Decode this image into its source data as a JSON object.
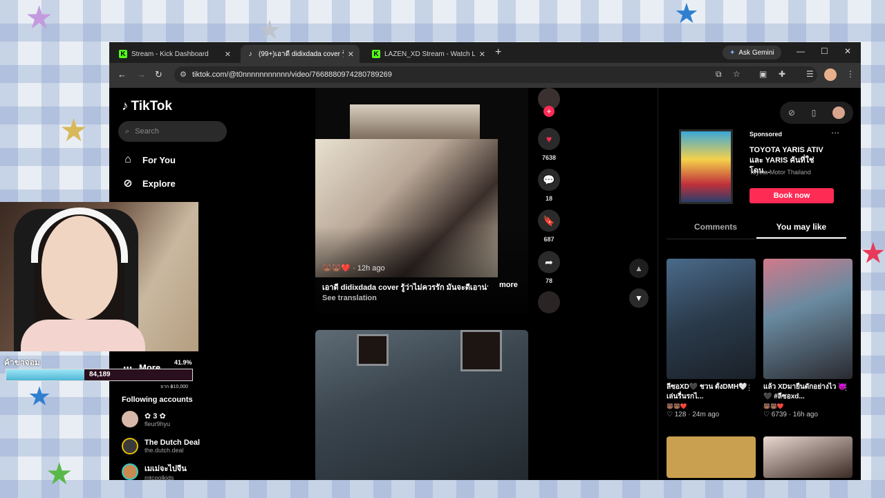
{
  "browser": {
    "tabs": [
      {
        "title": "Stream - Kick Dashboard",
        "favicon": "kick-icon"
      },
      {
        "title": "(99+)เอาดี didixdada cover รู้ว่าไม่",
        "favicon": "tiktok-icon"
      },
      {
        "title": "LAZEN_XD Stream - Watch Live",
        "favicon": "kick-icon"
      }
    ],
    "ask_gemini": "Ask Gemini",
    "url": "tiktok.com/@t0nnnnnnnnnnn/video/7668880974280789269"
  },
  "sidebar": {
    "logo": "TikTok",
    "search_placeholder": "Search",
    "nav": [
      {
        "label": "For You",
        "icon": "home-icon"
      },
      {
        "label": "Explore",
        "icon": "compass-icon"
      }
    ],
    "more": "More",
    "following_header": "Following accounts",
    "following": [
      {
        "name": "✿ 3 ✿",
        "handle": "fleur9hyu"
      },
      {
        "name": "The Dutch Deal",
        "handle": "the.dutch.deal"
      },
      {
        "name": "เมเม่จะไปจีน",
        "handle": "mtcoolkids"
      }
    ]
  },
  "video": {
    "time": "12h ago",
    "caption": "เอาดี didixdada cover รู้ว่าไม่ควรรัก มันจะดีเอาน่า",
    "more": "more",
    "see_translation": "See translation"
  },
  "actions": {
    "likes": "7638",
    "comments": "18",
    "saves": "687",
    "shares": "78"
  },
  "ad": {
    "sponsored": "Sponsored",
    "title": "TOYOTA YARIS ATIV และ YARIS คันที่ใช่ โดน...",
    "brand": "Toyota Motor Thailand",
    "cta": "Book now"
  },
  "right_tabs": [
    "Comments",
    "You may like"
  ],
  "cards": [
    {
      "title": "ลีซอXD🖤 ชวน ตั้งDMH🤍 เล่นรื่นรกไ...",
      "emoji": "🐻🐻❤️",
      "likes": "128",
      "time": "24m ago"
    },
    {
      "title": "แล้ว XDมายืนดักอย่างไว 👿🖤 #ลีซอxd...",
      "emoji": "🐻🐻❤️",
      "likes": "6739",
      "time": "16h ago"
    }
  ],
  "stream_overlay": {
    "goal_label": "ค้าขาจอม",
    "goal_value": "84,189",
    "goal_percent": "41.9%",
    "goal_target": "จาก ฿10,000",
    "goal_fraction": 0.419
  },
  "colors": {
    "accent": "#fe2c55",
    "kick_green": "#53fc18",
    "goal_fill": "#4fb5d4"
  }
}
